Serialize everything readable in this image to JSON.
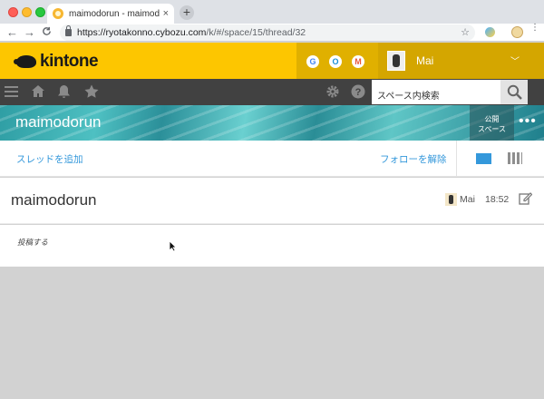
{
  "browser": {
    "tab_title": "maimodorun - maimodorun",
    "tab_close": "×",
    "new_tab": "+",
    "back": "←",
    "forward": "→",
    "reload": "C",
    "url_host": "https://ryotakonno.cybozu.com",
    "url_path": "/k/#/space/15/thread/32",
    "bookmark": "☆",
    "menu": "⋮"
  },
  "header": {
    "logo_text": "kintone",
    "app_icons": [
      "G",
      "O",
      "M"
    ],
    "user_name": "Mai",
    "user_menu": "﹀"
  },
  "toolbar": {
    "search_placeholder": "スペース内検索"
  },
  "space": {
    "title": "maimodorun",
    "visibility_line1": "公開",
    "visibility_line2": "スペース",
    "more": "•••"
  },
  "thread_actions": {
    "add_thread": "スレッドを追加",
    "unfollow": "フォローを解除"
  },
  "thread": {
    "title": "maimodorun",
    "author": "Mai",
    "time": "18:52"
  },
  "post": {
    "post_label": "投稿する"
  },
  "colors": {
    "kintone_yellow": "#fdc600",
    "toolbar_dark": "#414141",
    "link_blue": "#3498db"
  }
}
